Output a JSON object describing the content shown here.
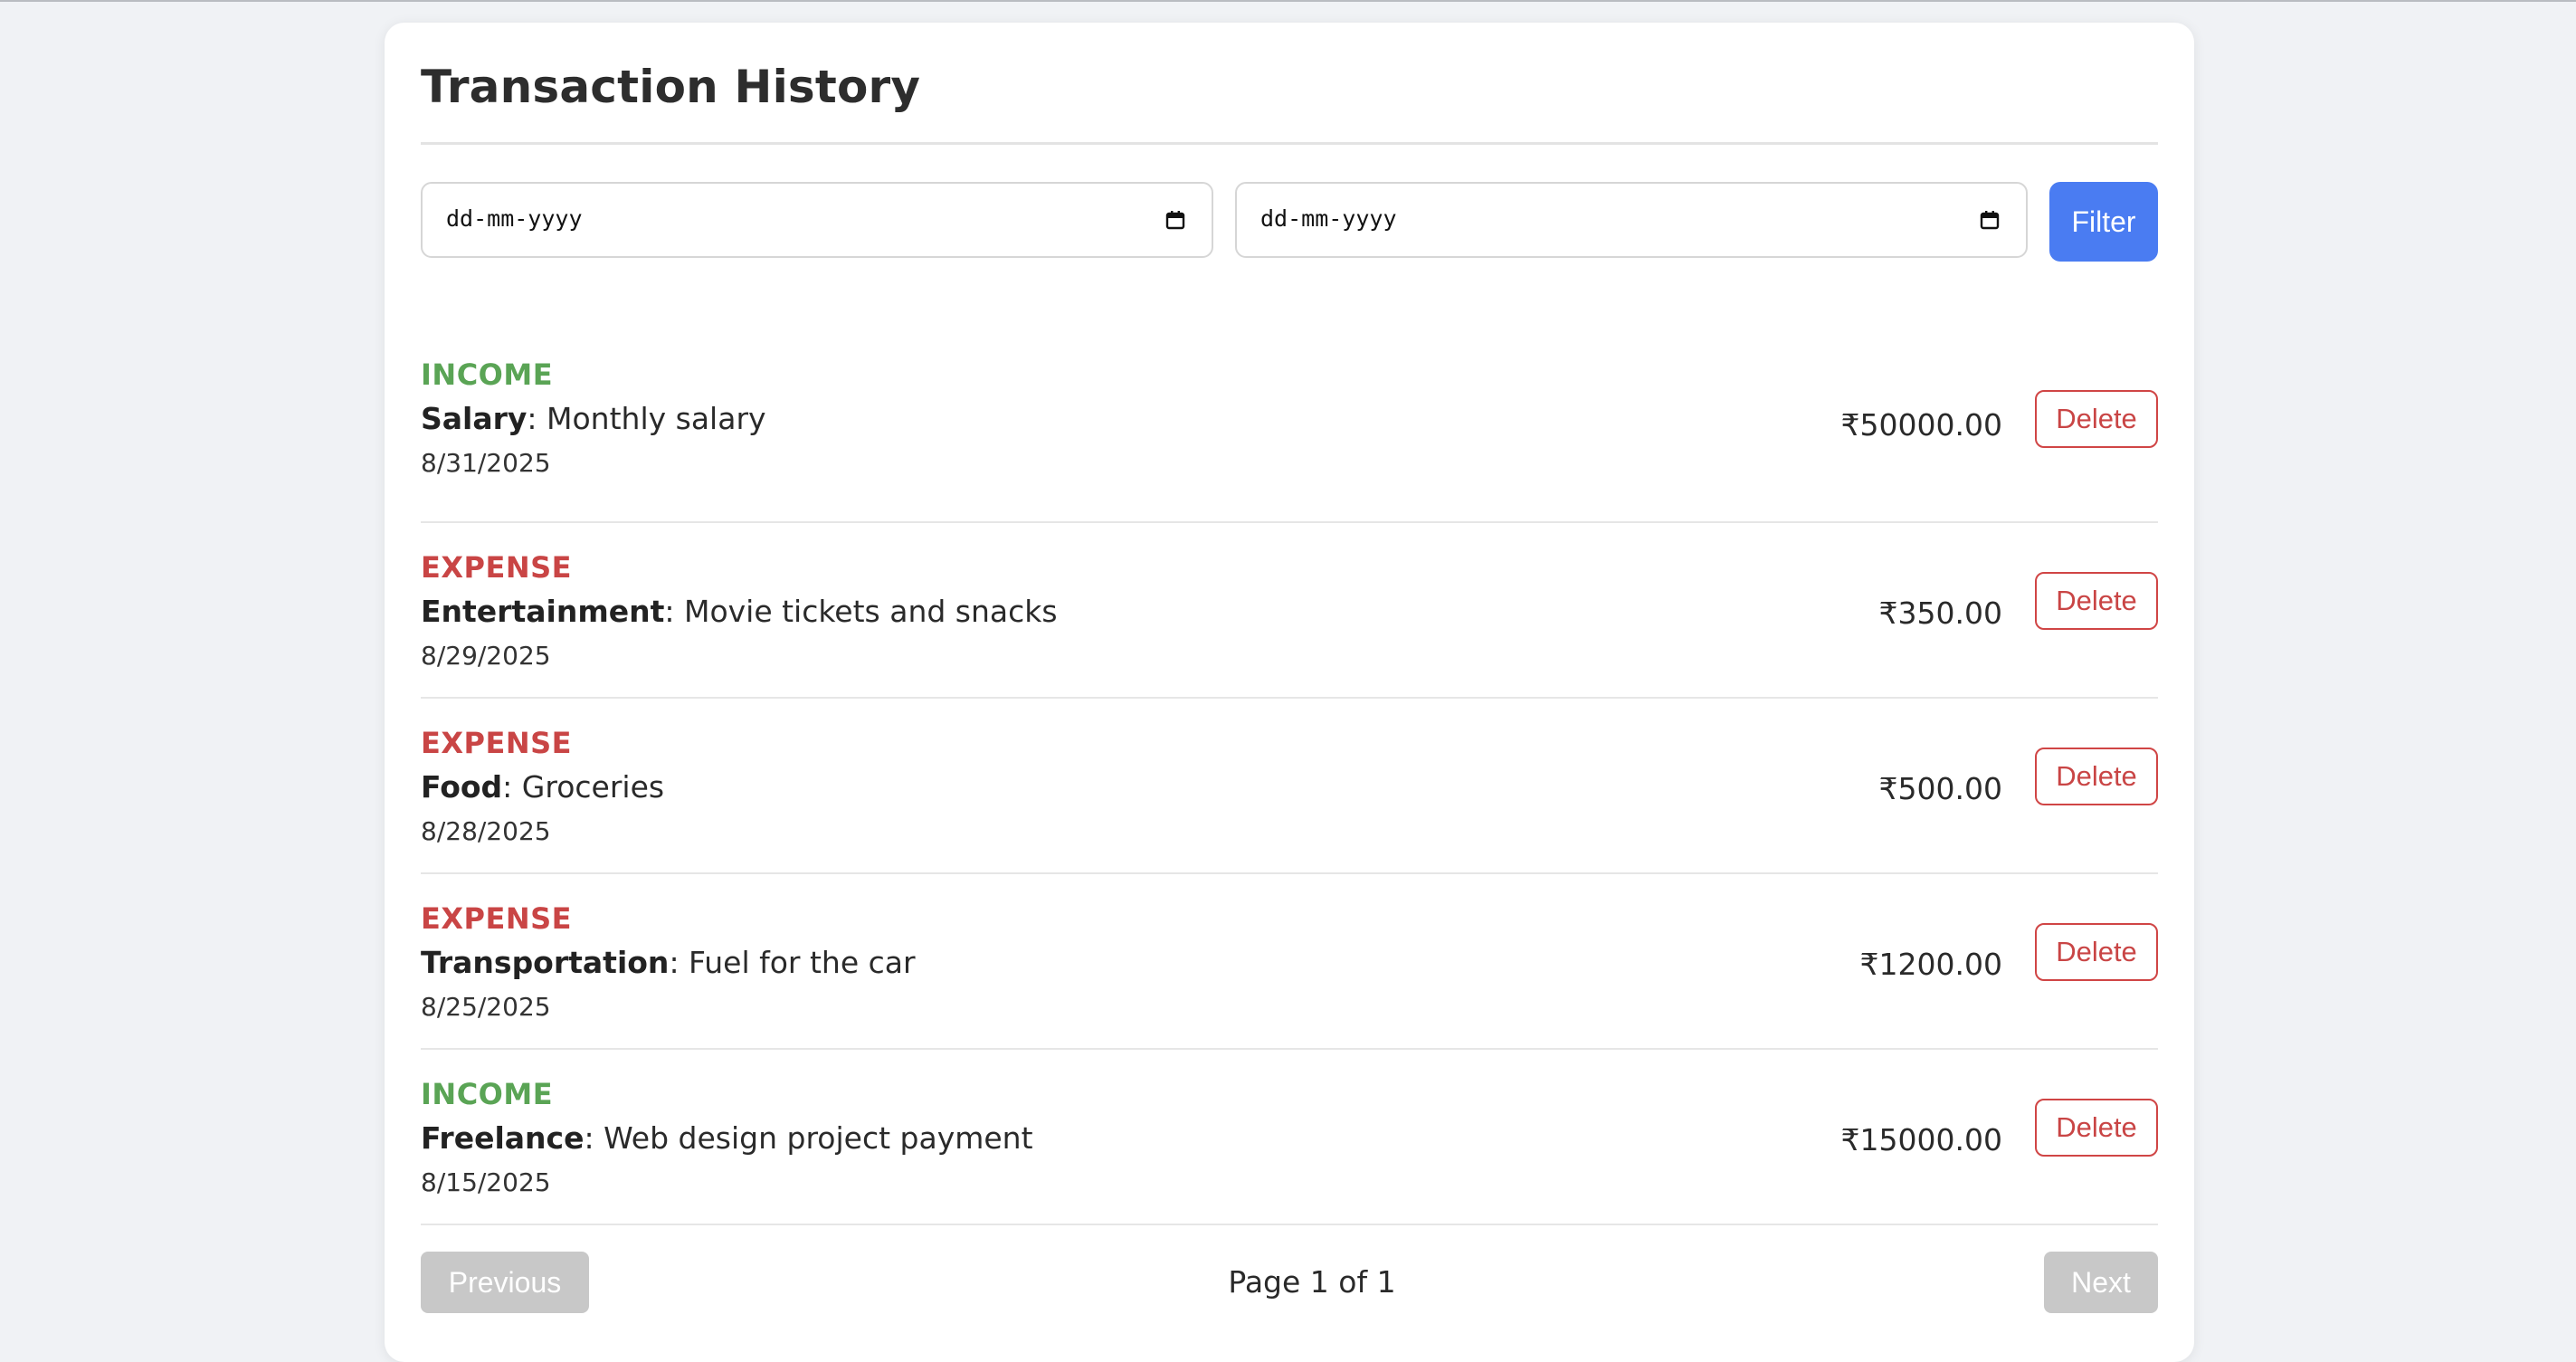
{
  "page": {
    "title": "Transaction History"
  },
  "filters": {
    "from_date_placeholder": "dd-mm-yyyy",
    "to_date_placeholder": "dd-mm-yyyy",
    "filter_label": "Filter"
  },
  "transactions": [
    {
      "type": "INCOME",
      "category": "Salary",
      "separator": ": ",
      "description": "Monthly salary",
      "date": "8/31/2025",
      "amount": "₹50000.00",
      "delete_label": "Delete"
    },
    {
      "type": "EXPENSE",
      "category": "Entertainment",
      "separator": ": ",
      "description": "Movie tickets and snacks",
      "date": "8/29/2025",
      "amount": "₹350.00",
      "delete_label": "Delete"
    },
    {
      "type": "EXPENSE",
      "category": "Food",
      "separator": ": ",
      "description": "Groceries",
      "date": "8/28/2025",
      "amount": "₹500.00",
      "delete_label": "Delete"
    },
    {
      "type": "EXPENSE",
      "category": "Transportation",
      "separator": ": ",
      "description": "Fuel for the car",
      "date": "8/25/2025",
      "amount": "₹1200.00",
      "delete_label": "Delete"
    },
    {
      "type": "INCOME",
      "category": "Freelance",
      "separator": ": ",
      "description": "Web design project payment",
      "date": "8/15/2025",
      "amount": "₹15000.00",
      "delete_label": "Delete"
    }
  ],
  "pagination": {
    "previous_label": "Previous",
    "page_info": "Page 1 of 1",
    "next_label": "Next"
  },
  "colors": {
    "income": "#5aa455",
    "expense": "#c94545",
    "primary": "#4a7cf2",
    "disabled": "#c8c8c8"
  },
  "icons": {
    "date_picker": "calendar-icon"
  }
}
